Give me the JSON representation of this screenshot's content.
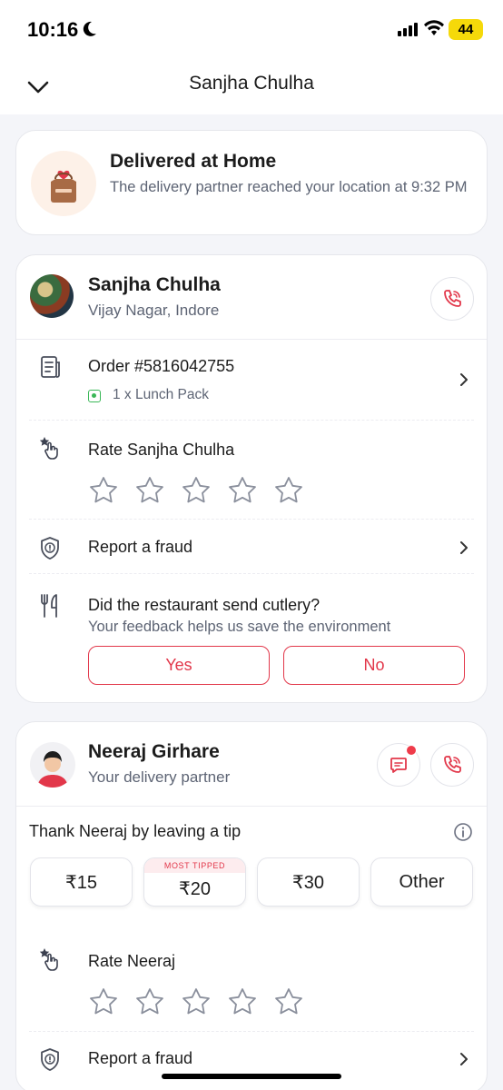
{
  "status_bar": {
    "time": "10:16",
    "battery": "44"
  },
  "header": {
    "title": "Sanjha Chulha"
  },
  "delivery": {
    "title": "Delivered at Home",
    "subtitle": "The delivery partner reached your location at 9:32 PM"
  },
  "restaurant": {
    "name": "Sanjha Chulha",
    "location": "Vijay Nagar, Indore",
    "order_label": "Order #5816042755",
    "item": "1 x Lunch Pack",
    "rate_label": "Rate Sanjha Chulha",
    "rating_stars": 5,
    "report_label": "Report a fraud",
    "cutlery_question": "Did the restaurant send cutlery?",
    "cutlery_sub": "Your feedback helps us save the environment",
    "yes_label": "Yes",
    "no_label": "No"
  },
  "partner": {
    "name": "Neeraj Girhare",
    "role": "Your delivery partner",
    "tip_label": "Thank Neeraj by leaving a tip",
    "tips": [
      {
        "label": "₹15"
      },
      {
        "label": "₹20",
        "badge": "MOST TIPPED"
      },
      {
        "label": "₹30"
      },
      {
        "label": "Other"
      }
    ],
    "rate_label": "Rate Neeraj",
    "report_label": "Report a fraud"
  },
  "colors": {
    "accent": "#e2374a",
    "veg": "#3ab757",
    "battery": "#f5d90a"
  }
}
